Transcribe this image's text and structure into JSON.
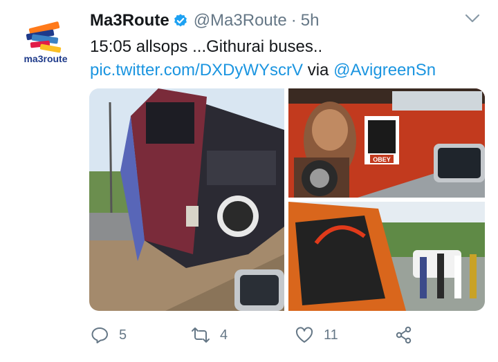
{
  "tweet": {
    "display_name": "Ma3Route",
    "handle": "@Ma3Route",
    "separator": "·",
    "time": "5h",
    "text_line1": "15:05 allsops ...Githurai buses..",
    "media_link": "pic.twitter.com/DXDyWYscrV",
    "via_word": "via",
    "via_handle": "@AvigreenSn",
    "avatar_logo_text": "ma3route"
  },
  "actions": {
    "reply_count": "5",
    "retweet_count": "4",
    "like_count": "11"
  },
  "colors": {
    "link": "#1b95e0",
    "muted": "#657786",
    "verified": "#1da1f2"
  },
  "icons": {
    "verified": "verified-badge-icon",
    "menu": "chevron-down-icon",
    "reply": "reply-icon",
    "retweet": "retweet-icon",
    "like": "heart-icon",
    "share": "share-icon"
  },
  "media": {
    "sign_text": "OBEY"
  }
}
